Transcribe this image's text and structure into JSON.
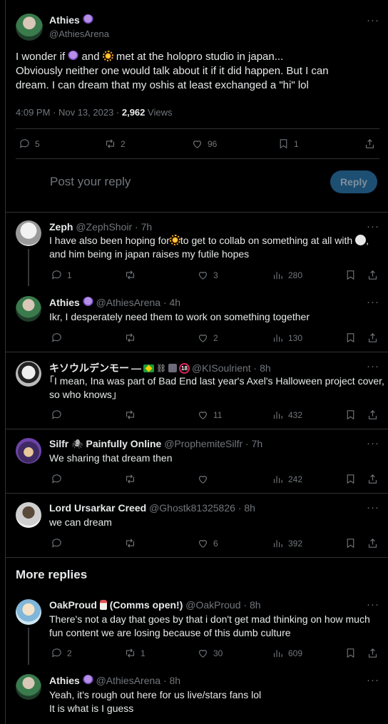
{
  "main_post": {
    "author_name": "Athies",
    "handle": "@AthiesArena",
    "line1_a": "I wonder if",
    "line1_b": "and",
    "line1_c": "met at the holopro studio in japan...",
    "line2": "Obviously neither one would talk about it if it did happen. But I can",
    "line3": "dream. I can dream that my oshis at least exchanged a \"hi\" lol",
    "time": "4:09 PM · Nov 13, 2023 · ",
    "views_count": "2,962",
    "views_label": " Views",
    "replies": "5",
    "reposts": "2",
    "likes": "96",
    "bookmarks": "1"
  },
  "composer": {
    "placeholder": "Post your reply",
    "button": "Reply"
  },
  "replies": [
    {
      "name": "Zeph",
      "meta": "@ZephShoir · 7h",
      "text1_a": "I have also been hoping for",
      "text1_b": "to get to collab on something at all with",
      "text1_c": ",",
      "text2": "and him being in japan raises my futile hopes",
      "replies": "1",
      "reposts": "",
      "likes": "3",
      "views": "280"
    },
    {
      "name": "Athies",
      "meta": "@AthiesArena · 4h",
      "text1": "Ikr, I desperately need them to work on something together",
      "replies": "",
      "reposts": "",
      "likes": "2",
      "views": "130"
    },
    {
      "name": "キソウルデンモー",
      "name_tail": "—",
      "meta": "@KISoulrient · 8h",
      "text1": "｢I mean, Ina was part of Bad End last year's Axel's Halloween project cover,",
      "text2": "so who knows｣",
      "replies": "",
      "reposts": "",
      "likes": "11",
      "views": "432"
    },
    {
      "name": "Silfr",
      "name2": "Painfully Online",
      "meta": "@ProphemiteSilfr · 7h",
      "text1": "We sharing that dream then",
      "replies": "",
      "reposts": "",
      "likes": "",
      "views": "242"
    },
    {
      "name": "Lord Ursarkar Creed",
      "meta": "@Ghostk81325826 · 8h",
      "text1": "we can dream",
      "replies": "",
      "reposts": "",
      "likes": "6",
      "views": "392"
    }
  ],
  "more_replies": {
    "heading": "More replies",
    "items": [
      {
        "name": "OakProud",
        "name2": "(Comms open!)",
        "meta": "@OakProud · 8h",
        "text1": "There's not a day that goes by that i don't get mad thinking on how much",
        "text2": "fun content we are losing because of this dumb culture",
        "replies": "2",
        "reposts": "1",
        "likes": "30",
        "views": "609"
      },
      {
        "name": "Athies",
        "meta": "@AthiesArena · 8h",
        "text1": "Yeah, it's rough out here for us live/stars fans lol",
        "text2": "It is what is I guess"
      }
    ]
  },
  "colors": {
    "background": "#000000",
    "text": "#e7e9ea",
    "muted": "#71767b",
    "border": "#2f3336",
    "reply_button": "#1d4f73"
  },
  "icons": [
    "more-icon",
    "reply-icon",
    "repost-icon",
    "like-icon",
    "bookmark-icon",
    "share-icon",
    "views-icon",
    "octopus-emoji-icon",
    "sun-emoji-icon",
    "skull-emoji-icon",
    "spider-emoji-icon"
  ]
}
